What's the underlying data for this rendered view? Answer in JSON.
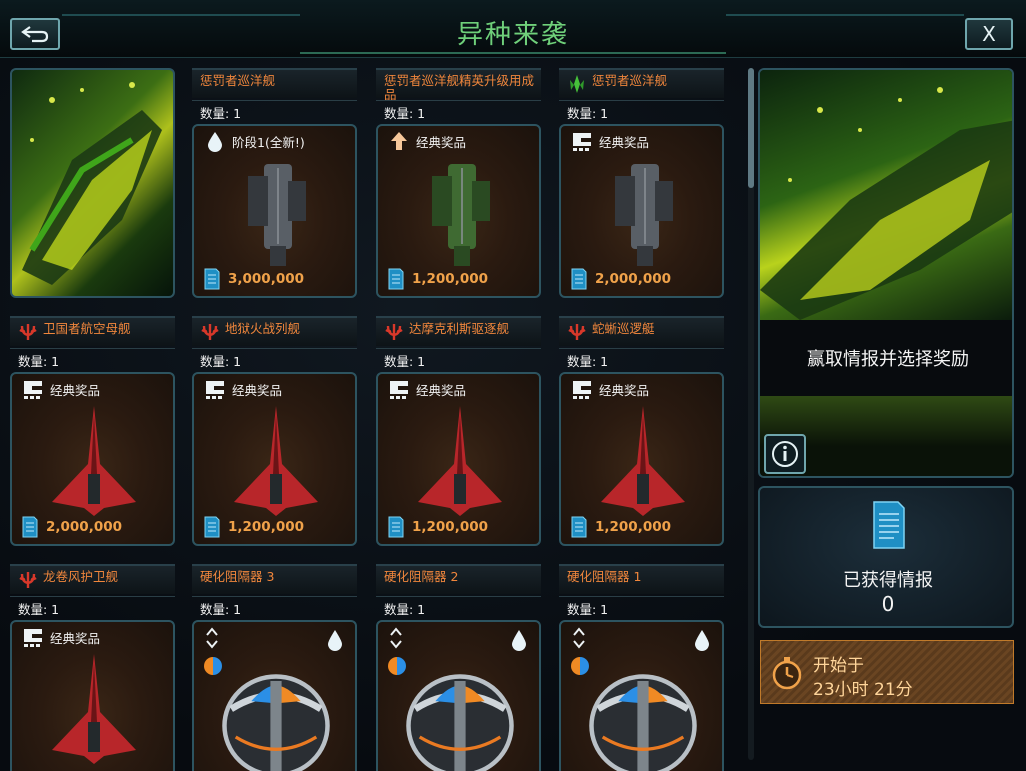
{
  "header": {
    "title": "异种来袭",
    "close_label": "X"
  },
  "tiles": [
    {
      "name": "惩罚者巡洋舰",
      "qty": "数量: 1",
      "type": "阶段1(全新!)",
      "price": "3,000,000",
      "faction": "none",
      "type_icon": "drop-icon",
      "ship": "gray"
    },
    {
      "name": "惩罚者巡洋舰精英升级用成品",
      "qty": "数量: 1",
      "type": "经典奖品",
      "price": "1,200,000",
      "faction": "none",
      "type_icon": "arrow-up-icon",
      "ship": "green"
    },
    {
      "name": "惩罚者巡洋舰",
      "qty": "数量: 1",
      "type": "经典奖品",
      "price": "2,000,000",
      "faction": "green",
      "type_icon": "classic-prize-icon",
      "ship": "gray"
    },
    {
      "name": "卫国者航空母舰",
      "qty": "数量: 1",
      "type": "经典奖品",
      "price": "2,000,000",
      "faction": "red",
      "type_icon": "classic-prize-icon",
      "ship": "red"
    },
    {
      "name": "地狱火战列舰",
      "qty": "数量: 1",
      "type": "经典奖品",
      "price": "1,200,000",
      "faction": "red",
      "type_icon": "classic-prize-icon",
      "ship": "red"
    },
    {
      "name": "达摩克利斯驱逐舰",
      "qty": "数量: 1",
      "type": "经典奖品",
      "price": "1,200,000",
      "faction": "red",
      "type_icon": "classic-prize-icon",
      "ship": "red"
    },
    {
      "name": "蛇蜥巡逻艇",
      "qty": "数量: 1",
      "type": "经典奖品",
      "price": "1,200,000",
      "faction": "red",
      "type_icon": "classic-prize-icon",
      "ship": "red"
    },
    {
      "name": "龙卷风护卫舰",
      "qty": "数量: 1",
      "type": "经典奖品",
      "price": "",
      "faction": "red",
      "type_icon": "classic-prize-icon",
      "ship": "red"
    },
    {
      "name": "硬化阻隔器 3",
      "qty": "数量: 1",
      "type": "",
      "price": "",
      "faction": "none",
      "type_icon": "module-icon",
      "ship": "sphere"
    },
    {
      "name": "硬化阻隔器 2",
      "qty": "数量: 1",
      "type": "",
      "price": "",
      "faction": "none",
      "type_icon": "module-icon",
      "ship": "sphere"
    },
    {
      "name": "硬化阻隔器 1",
      "qty": "数量: 1",
      "type": "",
      "price": "",
      "faction": "none",
      "type_icon": "module-icon",
      "ship": "sphere"
    }
  ],
  "side": {
    "prompt": "赢取情报并选择奖励"
  },
  "intel": {
    "label": "已获得情报",
    "value": "0"
  },
  "timer": {
    "line1": "开始于",
    "line2": "23小时 21分"
  },
  "colors": {
    "accent": "#6fd07a",
    "name_orange": "#f0863c",
    "price_orange": "#f0a24a",
    "border": "#2d5460"
  }
}
